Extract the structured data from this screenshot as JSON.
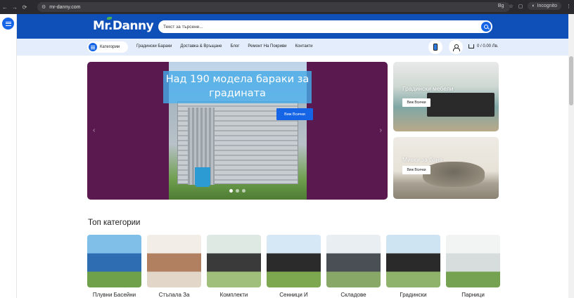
{
  "browser": {
    "url": "mr-danny.com",
    "lang_badge": "Bg",
    "incognito_label": "Incognito"
  },
  "header": {
    "logo": "Mr.Danny",
    "search_placeholder": "Текст за търсене..."
  },
  "subnav": {
    "categories_label": "Категории",
    "links": [
      "Градински Бараки",
      "Доставка & Връщане",
      "Блог",
      "Ремонт На Покриви",
      "Контакти"
    ],
    "cart_total": "0 / 0.00 Лв."
  },
  "hero": {
    "title": "Над 190 модела бараки за градината",
    "button": "Виж Всички",
    "slides": 3,
    "active_slide": 1
  },
  "promos": [
    {
      "title": "Градински мебели",
      "button": "Виж Всички"
    },
    {
      "title": "Мивки за баня",
      "button": "Виж Всички"
    }
  ],
  "top_categories": {
    "title": "Топ категории",
    "items": [
      {
        "name": "Плувни Басейни",
        "icon": "pool-image",
        "colors": [
          "#7fbfe8",
          "#2f6db3",
          "#6fa04a"
        ]
      },
      {
        "name": "Стъпала За",
        "icon": "stair-mats-image",
        "colors": [
          "#f3ede7",
          "#b08060",
          "#e2d6c8"
        ]
      },
      {
        "name": "Комплекти",
        "icon": "furniture-set-image",
        "colors": [
          "#dfe9e3",
          "#3a3a3a",
          "#9fbf7a"
        ]
      },
      {
        "name": "Сенници И",
        "icon": "gazebo-image",
        "colors": [
          "#d6e7f5",
          "#2b2b2b",
          "#7da84f"
        ]
      },
      {
        "name": "Складове",
        "icon": "storage-shed-image",
        "colors": [
          "#e8eef2",
          "#4a4f55",
          "#88a867"
        ]
      },
      {
        "name": "Градински",
        "icon": "umbrella-image",
        "colors": [
          "#cfe4f2",
          "#2a2a2a",
          "#8fb36a"
        ]
      },
      {
        "name": "Парници",
        "icon": "greenhouse-image",
        "colors": [
          "#f1f4f3",
          "#d7dcdc",
          "#75a250"
        ]
      }
    ]
  }
}
